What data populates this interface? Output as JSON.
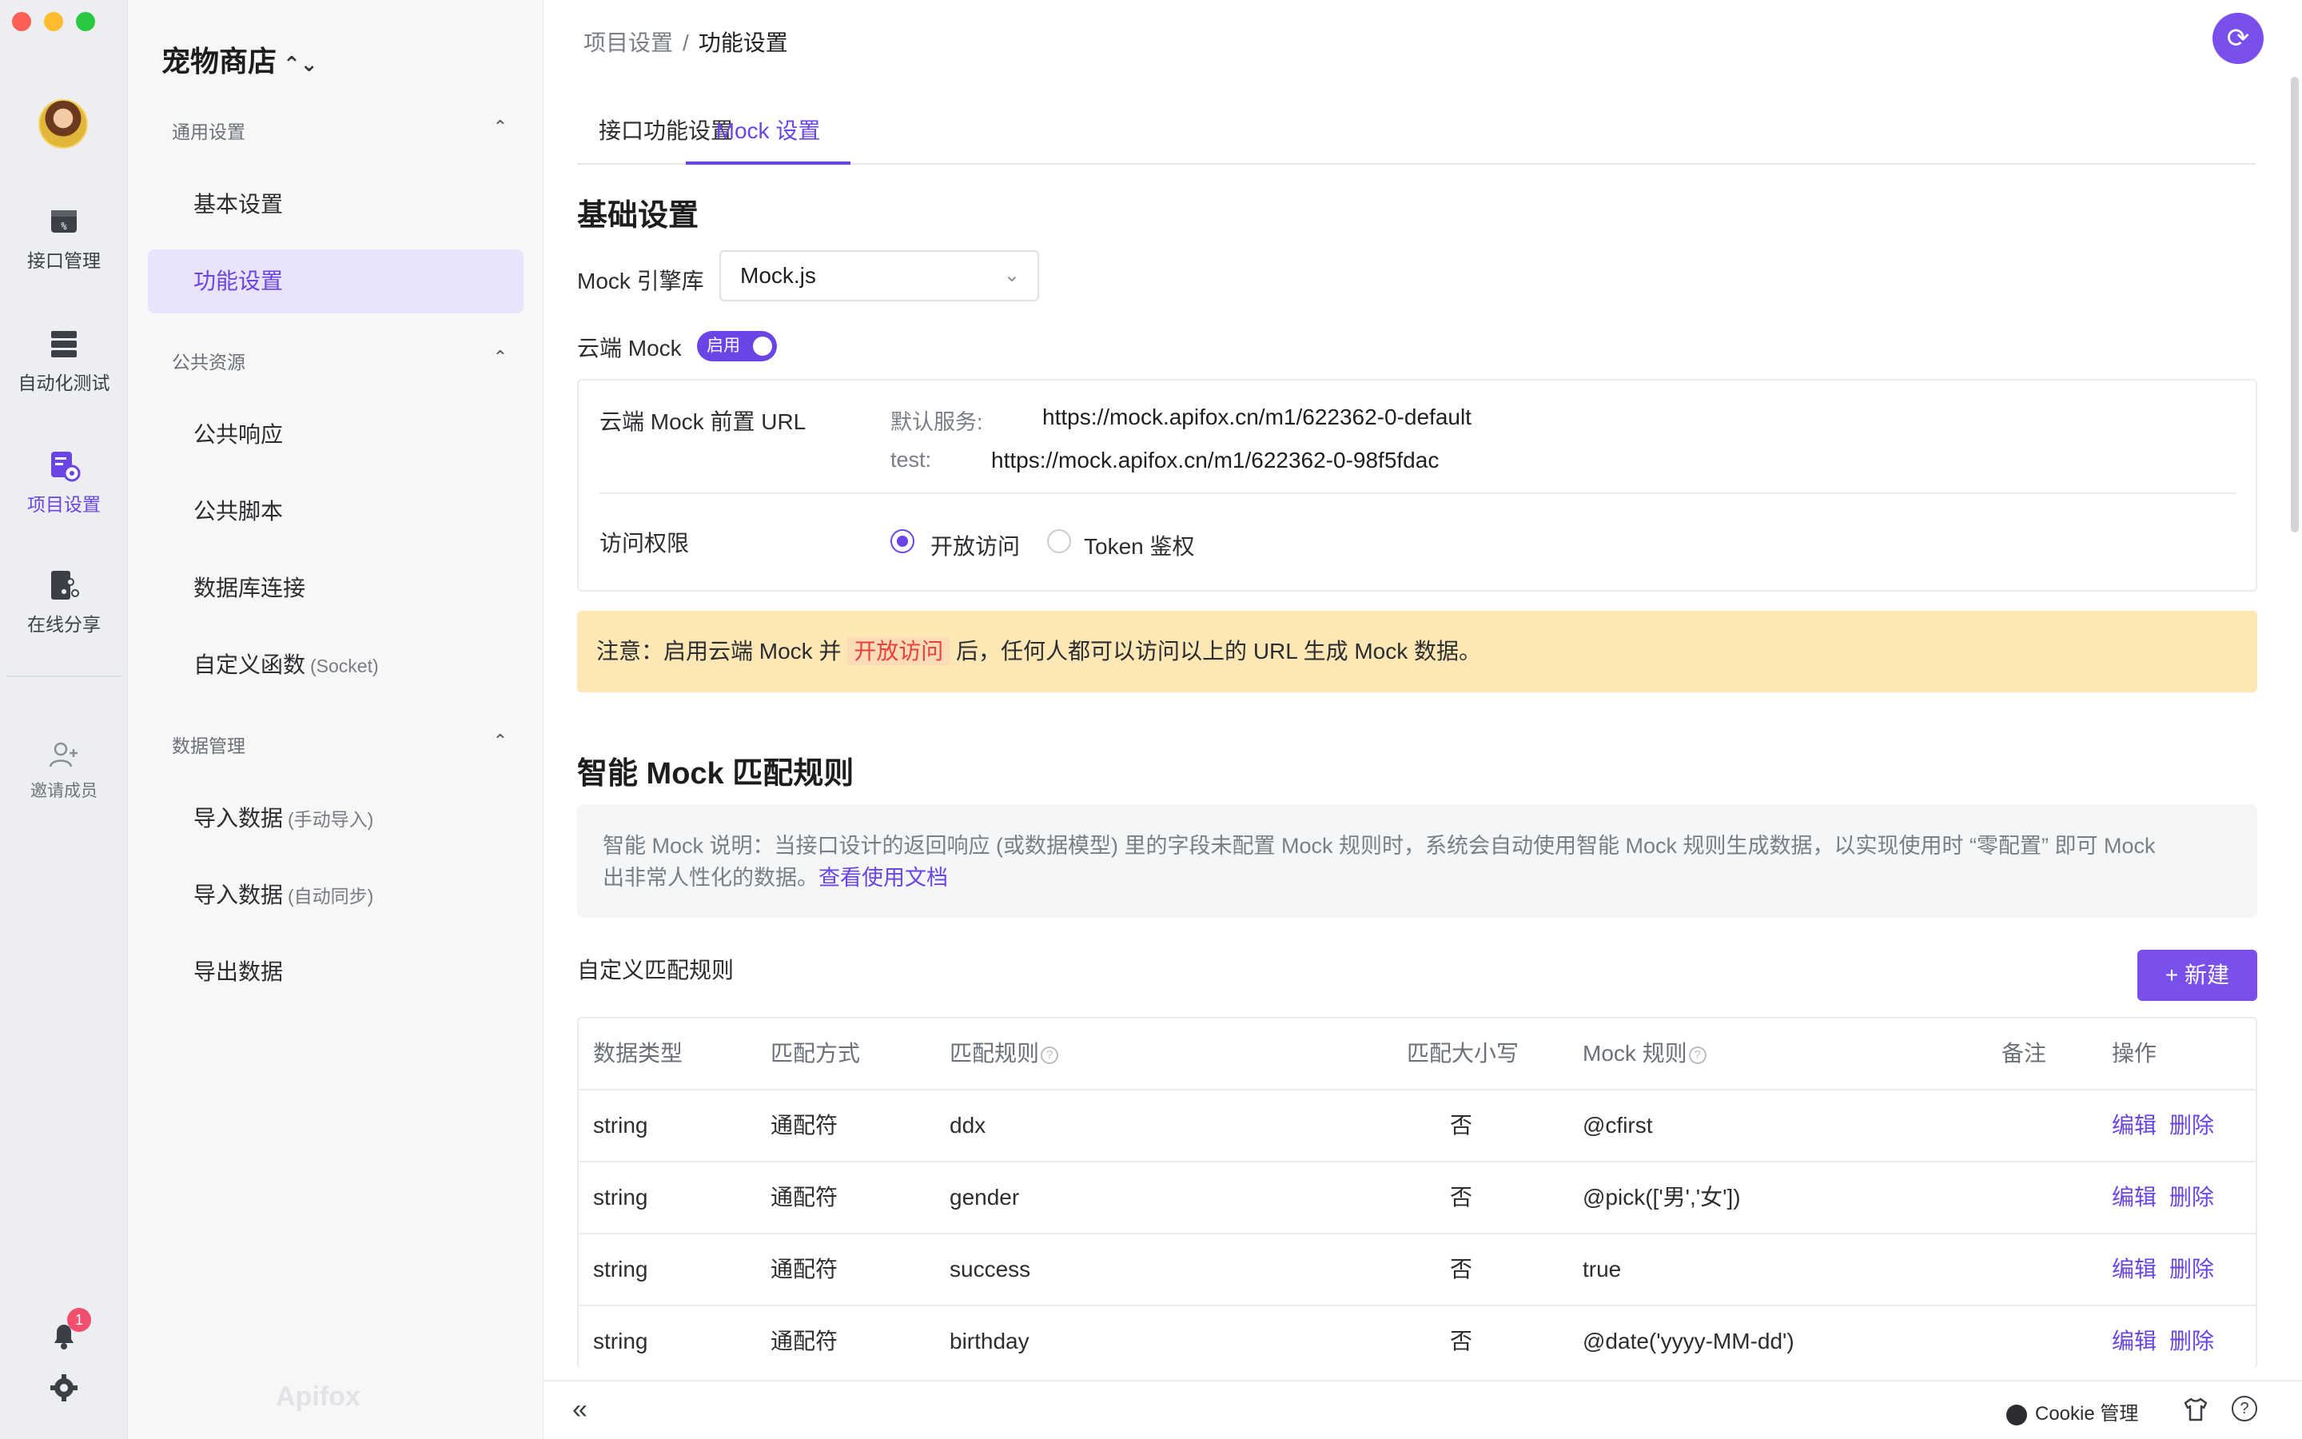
{
  "rail": {
    "items": [
      {
        "label": "接口管理",
        "icon": "api-management-icon"
      },
      {
        "label": "自动化测试",
        "icon": "automation-test-icon"
      },
      {
        "label": "项目设置",
        "icon": "project-settings-icon"
      },
      {
        "label": "在线分享",
        "icon": "online-share-icon"
      }
    ],
    "invite_label": "邀请成员",
    "notification_count": "1"
  },
  "sidebar": {
    "project_name": "宠物商店",
    "groups": [
      {
        "label": "通用设置",
        "items": [
          {
            "label": "基本设置"
          },
          {
            "label": "功能设置"
          }
        ]
      },
      {
        "label": "公共资源",
        "items": [
          {
            "label": "公共响应"
          },
          {
            "label": "公共脚本"
          },
          {
            "label": "数据库连接"
          },
          {
            "label": "自定义函数",
            "note": "(Socket)"
          }
        ]
      },
      {
        "label": "数据管理",
        "items": [
          {
            "label": "导入数据",
            "note": "(手动导入)"
          },
          {
            "label": "导入数据",
            "note": "(自动同步)"
          },
          {
            "label": "导出数据"
          }
        ]
      }
    ],
    "watermark": "Apifox"
  },
  "breadcrumb": {
    "parent": "项目设置",
    "separator": "/",
    "current": "功能设置"
  },
  "tabs": [
    {
      "label": "接口功能设置"
    },
    {
      "label": "Mock 设置"
    }
  ],
  "basic": {
    "heading": "基础设置",
    "engine_label": "Mock 引擎库",
    "engine_value": "Mock.js",
    "cloud_label": "云端 Mock",
    "cloud_toggle": "启用",
    "url_label": "云端 Mock 前置 URL",
    "urls": [
      {
        "key": "默认服务:",
        "value": "https://mock.apifox.cn/m1/622362-0-default"
      },
      {
        "key": "test:",
        "value": "https://mock.apifox.cn/m1/622362-0-98f5fdac"
      }
    ],
    "access_label": "访问权限",
    "access_options": [
      {
        "label": "开放访问",
        "selected": true
      },
      {
        "label": "Token 鉴权",
        "selected": false
      }
    ]
  },
  "notice": {
    "prefix": "注意：启用云端 Mock 并",
    "highlight": "开放访问",
    "suffix": "后，任何人都可以访问以上的 URL 生成 Mock 数据。"
  },
  "smart": {
    "heading": "智能 Mock 匹配规则",
    "desc_line1": "智能 Mock 说明：当接口设计的返回响应 (或数据模型) 里的字段未配置 Mock 规则时，系统会自动使用智能 Mock 规则生成数据，以实现使用时 “零配置” 即可 Mock",
    "desc_line2": "出非常人性化的数据。",
    "doc_link": "查看使用文档",
    "custom_label": "自定义匹配规则",
    "new_button": "+ 新建"
  },
  "table": {
    "headers": [
      "数据类型",
      "匹配方式",
      "匹配规则",
      "匹配大小写",
      "Mock 规则",
      "备注",
      "操作"
    ],
    "rows": [
      {
        "type": "string",
        "match": "通配符",
        "rule": "ddx",
        "case": "否",
        "mock": "@cfirst",
        "note": "",
        "edit": "编辑",
        "del": "删除"
      },
      {
        "type": "string",
        "match": "通配符",
        "rule": "gender",
        "case": "否",
        "mock": "@pick(['男','女'])",
        "note": "",
        "edit": "编辑",
        "del": "删除"
      },
      {
        "type": "string",
        "match": "通配符",
        "rule": "success",
        "case": "否",
        "mock": "true",
        "note": "",
        "edit": "编辑",
        "del": "删除"
      },
      {
        "type": "string",
        "match": "通配符",
        "rule": "birthday",
        "case": "否",
        "mock": "@date('yyyy-MM-dd')",
        "note": "",
        "edit": "编辑",
        "del": "删除"
      }
    ]
  },
  "footer": {
    "cookie_label": "Cookie 管理"
  },
  "colors": {
    "accent": "#6b44e6",
    "notice_bg": "#fde7b4",
    "notice_highlight": "#e8413c"
  }
}
